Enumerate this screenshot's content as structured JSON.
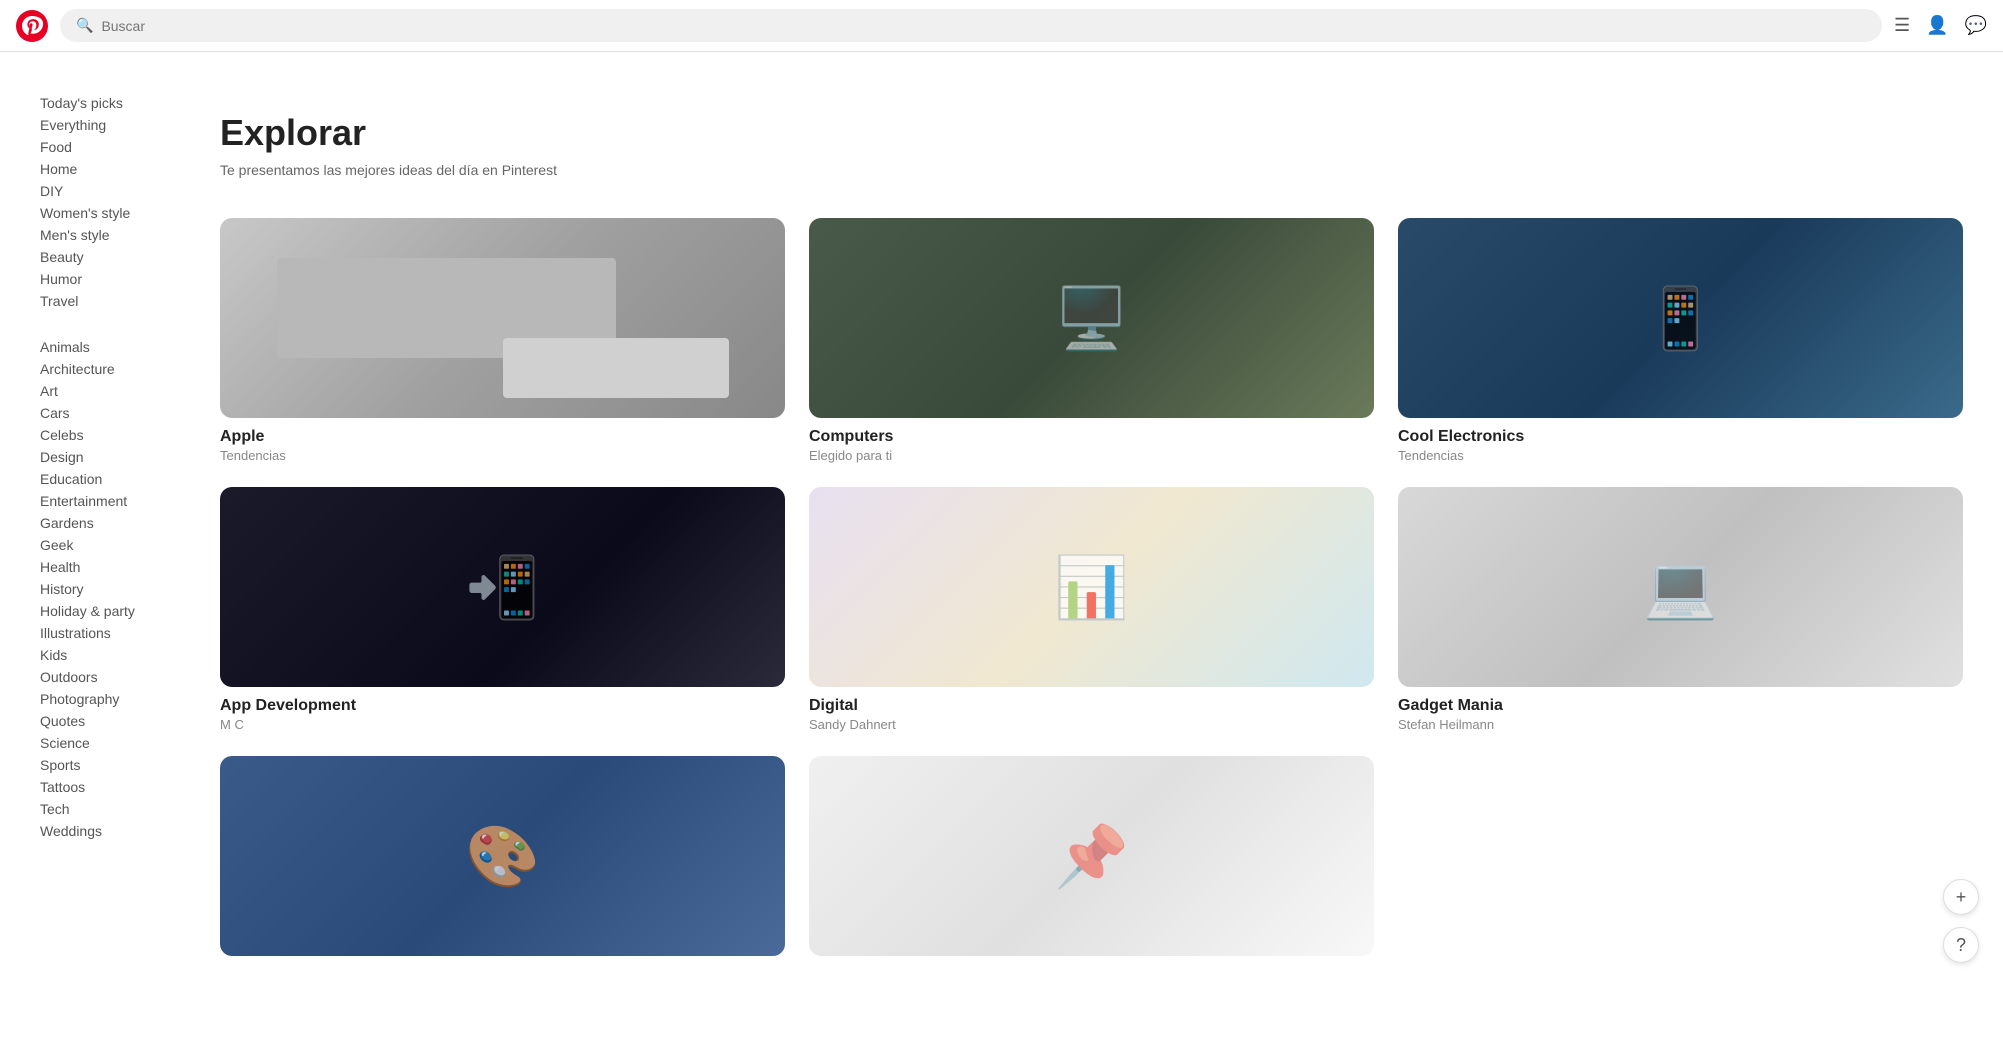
{
  "header": {
    "logo_alt": "Pinterest",
    "search_placeholder": "Buscar",
    "icon_menu": "☰",
    "icon_user": "👤",
    "icon_chat": "💬"
  },
  "sidebar": {
    "section1": {
      "items": [
        {
          "label": "Today's picks",
          "id": "todays-picks"
        },
        {
          "label": "Everything",
          "id": "everything"
        },
        {
          "label": "Food",
          "id": "food"
        },
        {
          "label": "Home",
          "id": "home"
        },
        {
          "label": "DIY",
          "id": "diy"
        },
        {
          "label": "Women's style",
          "id": "womens-style"
        },
        {
          "label": "Men's style",
          "id": "mens-style"
        },
        {
          "label": "Beauty",
          "id": "beauty"
        },
        {
          "label": "Humor",
          "id": "humor"
        },
        {
          "label": "Travel",
          "id": "travel"
        }
      ]
    },
    "section2": {
      "items": [
        {
          "label": "Animals",
          "id": "animals"
        },
        {
          "label": "Architecture",
          "id": "architecture"
        },
        {
          "label": "Art",
          "id": "art"
        },
        {
          "label": "Cars",
          "id": "cars"
        },
        {
          "label": "Celebs",
          "id": "celebs"
        },
        {
          "label": "Design",
          "id": "design"
        },
        {
          "label": "Education",
          "id": "education"
        },
        {
          "label": "Entertainment",
          "id": "entertainment"
        },
        {
          "label": "Gardens",
          "id": "gardens"
        },
        {
          "label": "Geek",
          "id": "geek"
        },
        {
          "label": "Health",
          "id": "health"
        },
        {
          "label": "History",
          "id": "history"
        },
        {
          "label": "Holiday & party",
          "id": "holiday-party"
        },
        {
          "label": "Illustrations",
          "id": "illustrations"
        },
        {
          "label": "Kids",
          "id": "kids"
        },
        {
          "label": "Outdoors",
          "id": "outdoors"
        },
        {
          "label": "Photography",
          "id": "photography"
        },
        {
          "label": "Quotes",
          "id": "quotes"
        },
        {
          "label": "Science",
          "id": "science"
        },
        {
          "label": "Sports",
          "id": "sports"
        },
        {
          "label": "Tattoos",
          "id": "tattoos"
        },
        {
          "label": "Tech",
          "id": "tech"
        },
        {
          "label": "Weddings",
          "id": "weddings"
        }
      ]
    }
  },
  "page": {
    "title": "Explorar",
    "subtitle": "Te presentamos las mejores ideas del día en Pinterest"
  },
  "boards": [
    {
      "id": "apple",
      "title": "Apple",
      "subtitle": "Tendencias",
      "img_class": "img-apple"
    },
    {
      "id": "computers",
      "title": "Computers",
      "subtitle": "Elegido para ti",
      "img_class": "img-computers"
    },
    {
      "id": "cool-electronics",
      "title": "Cool Electronics",
      "subtitle": "Tendencias",
      "img_class": "img-cool-electronics"
    },
    {
      "id": "app-development",
      "title": "App Development",
      "subtitle": "M C",
      "img_class": "img-app-dev"
    },
    {
      "id": "digital",
      "title": "Digital",
      "subtitle": "Sandy Dahnert",
      "img_class": "img-digital"
    },
    {
      "id": "gadget-mania",
      "title": "Gadget Mania",
      "subtitle": "Stefan Heilmann",
      "img_class": "img-gadget"
    },
    {
      "id": "bottom1",
      "title": "",
      "subtitle": "",
      "img_class": "img-bottom1"
    },
    {
      "id": "bottom2",
      "title": "",
      "subtitle": "",
      "img_class": "img-bottom2"
    }
  ],
  "fab": {
    "add_label": "+",
    "help_label": "?"
  }
}
